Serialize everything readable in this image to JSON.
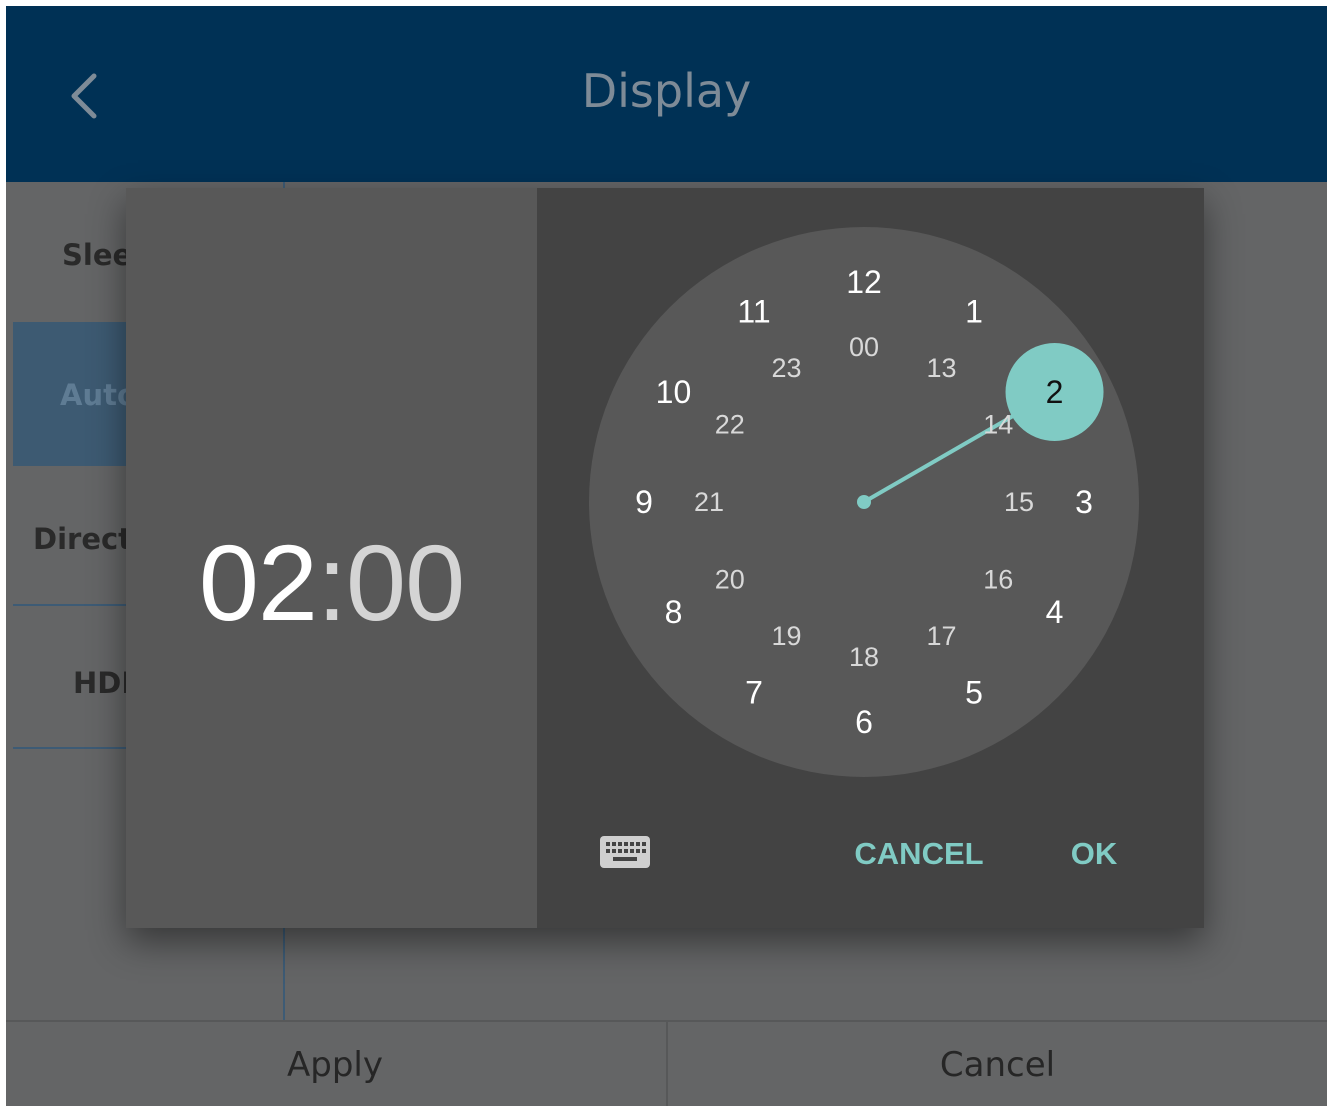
{
  "header": {
    "title": "Display",
    "back_icon": "chevron-left-icon"
  },
  "settings_list": {
    "items": [
      {
        "label": "Slee"
      },
      {
        "label": "Auto"
      },
      {
        "label": "Direct"
      },
      {
        "label": "HDI"
      }
    ]
  },
  "bottom_bar": {
    "apply_label": "Apply",
    "cancel_label": "Cancel"
  },
  "time_picker": {
    "hours": "02",
    "separator": ":",
    "minutes": "00",
    "selected_hour": 2,
    "outer_ring": [
      "12",
      "1",
      "2",
      "3",
      "4",
      "5",
      "6",
      "7",
      "8",
      "9",
      "10",
      "11"
    ],
    "inner_ring": [
      "00",
      "13",
      "14",
      "15",
      "16",
      "17",
      "18",
      "19",
      "20",
      "21",
      "22",
      "23"
    ],
    "keyboard_icon": "keyboard-icon",
    "cancel_label": "CANCEL",
    "ok_label": "OK",
    "colors": {
      "accent": "#80cbc4",
      "clock_face": "#585858",
      "panel": "#434343",
      "header_panel": "#585858"
    }
  }
}
